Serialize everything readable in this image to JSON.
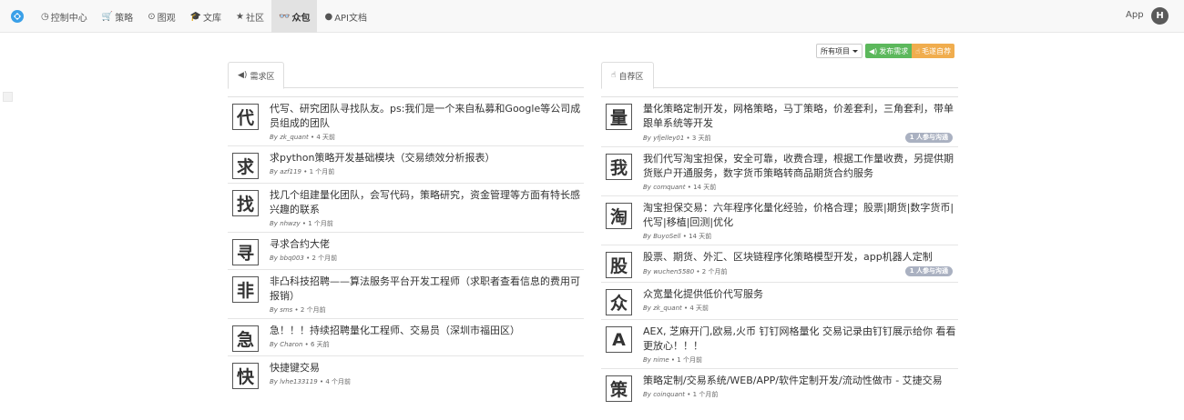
{
  "nav": {
    "items": [
      {
        "icon": "dashboard-icon",
        "glyph": "◷",
        "label": "控制中心"
      },
      {
        "icon": "cart-icon",
        "glyph": "🛒",
        "label": "策略"
      },
      {
        "icon": "play-icon",
        "glyph": "⊙",
        "label": "图观"
      },
      {
        "icon": "graduation-icon",
        "glyph": "🎓",
        "label": "文库"
      },
      {
        "icon": "star-icon",
        "glyph": "★",
        "label": "社区"
      },
      {
        "icon": "glasses-icon",
        "glyph": "👓",
        "label": "众包"
      },
      {
        "icon": "info-icon",
        "glyph": "●",
        "label": "API文档"
      }
    ],
    "active_index": 5,
    "app_label": "App",
    "avatar_letter": "H"
  },
  "actions": {
    "all_projects": "所有项目",
    "post_request": "发布需求",
    "self_recommend": "毛遂自荐"
  },
  "demand": {
    "tab_label": "需求区",
    "items": [
      {
        "char": "代",
        "title": "代写、研究团队寻找队友。ps:我们是一个来自私募和Google等公司成员组成的团队",
        "author": "zk_quant",
        "time": "4 天前"
      },
      {
        "char": "求",
        "title": "求python策略开发基础模块（交易绩效分析报表）",
        "author": "azf119",
        "time": "1 个月前"
      },
      {
        "char": "找",
        "title": "找几个组建量化团队，会写代码，策略研究，资金管理等方面有特长感兴趣的联系",
        "author": "nhwzy",
        "time": "1 个月前"
      },
      {
        "char": "寻",
        "title": "寻求合约大佬",
        "author": "bbq003",
        "time": "2 个月前"
      },
      {
        "char": "非",
        "title": "非凸科技招聘——算法服务平台开发工程师（求职者查看信息的费用可报销）",
        "author": "sms",
        "time": "2 个月前"
      },
      {
        "char": "急",
        "title": "急！！！持续招聘量化工程师、交易员（深圳市福田区）",
        "author": "Charon",
        "time": "6 天前"
      },
      {
        "char": "快",
        "title": "快捷键交易",
        "author": "lvhe133119",
        "time": "4 个月前"
      }
    ]
  },
  "supply": {
    "tab_label": "自荐区",
    "items": [
      {
        "char": "量",
        "title": "量化策略定制开发，网格策略，马丁策略，价差套利，三角套利，带单跟单系统等开发",
        "author": "yfjelley01",
        "time": "3 天前",
        "participants": "1 人参与沟通"
      },
      {
        "char": "我",
        "title": "我们代写淘宝担保，安全可靠，收费合理，根据工作量收费，另提供期货账户开通服务，数字货币策略转商品期货合约服务",
        "author": "comquant",
        "time": "14 天前"
      },
      {
        "char": "淘",
        "title": "淘宝担保交易：六年程序化量化经验，价格合理；股票|期货|数字货币|代写|移植|回测|优化",
        "author": "BuyoSell",
        "time": "14 天前"
      },
      {
        "char": "股",
        "title": "股票、期货、外汇、区块链程序化策略模型开发，app机器人定制",
        "author": "wuchen5580",
        "time": "2 个月前",
        "participants": "1 人参与沟通"
      },
      {
        "char": "众",
        "title": "众宽量化提供低价代写服务",
        "author": "zk_quant",
        "time": "4 天前"
      },
      {
        "char": "A",
        "title": "AEX, 芝麻开门,欧易,火币 钉钉网格量化 交易记录由钉钉展示给你 看看更放心！！！",
        "author": "nime",
        "time": "1 个月前"
      },
      {
        "char": "策",
        "title": "策略定制/交易系统/WEB/APP/软件定制开发/流动性做市 - 艾捷交易",
        "author": "coinquant",
        "time": "1 个月前"
      }
    ]
  },
  "by_prefix": "By",
  "colors": {
    "navbar_bg": "#f8f8f8",
    "active_bg": "#e2e2e2",
    "green": "#5cb85c",
    "orange": "#f0ad4e",
    "badge_gray": "#aab1c1"
  }
}
